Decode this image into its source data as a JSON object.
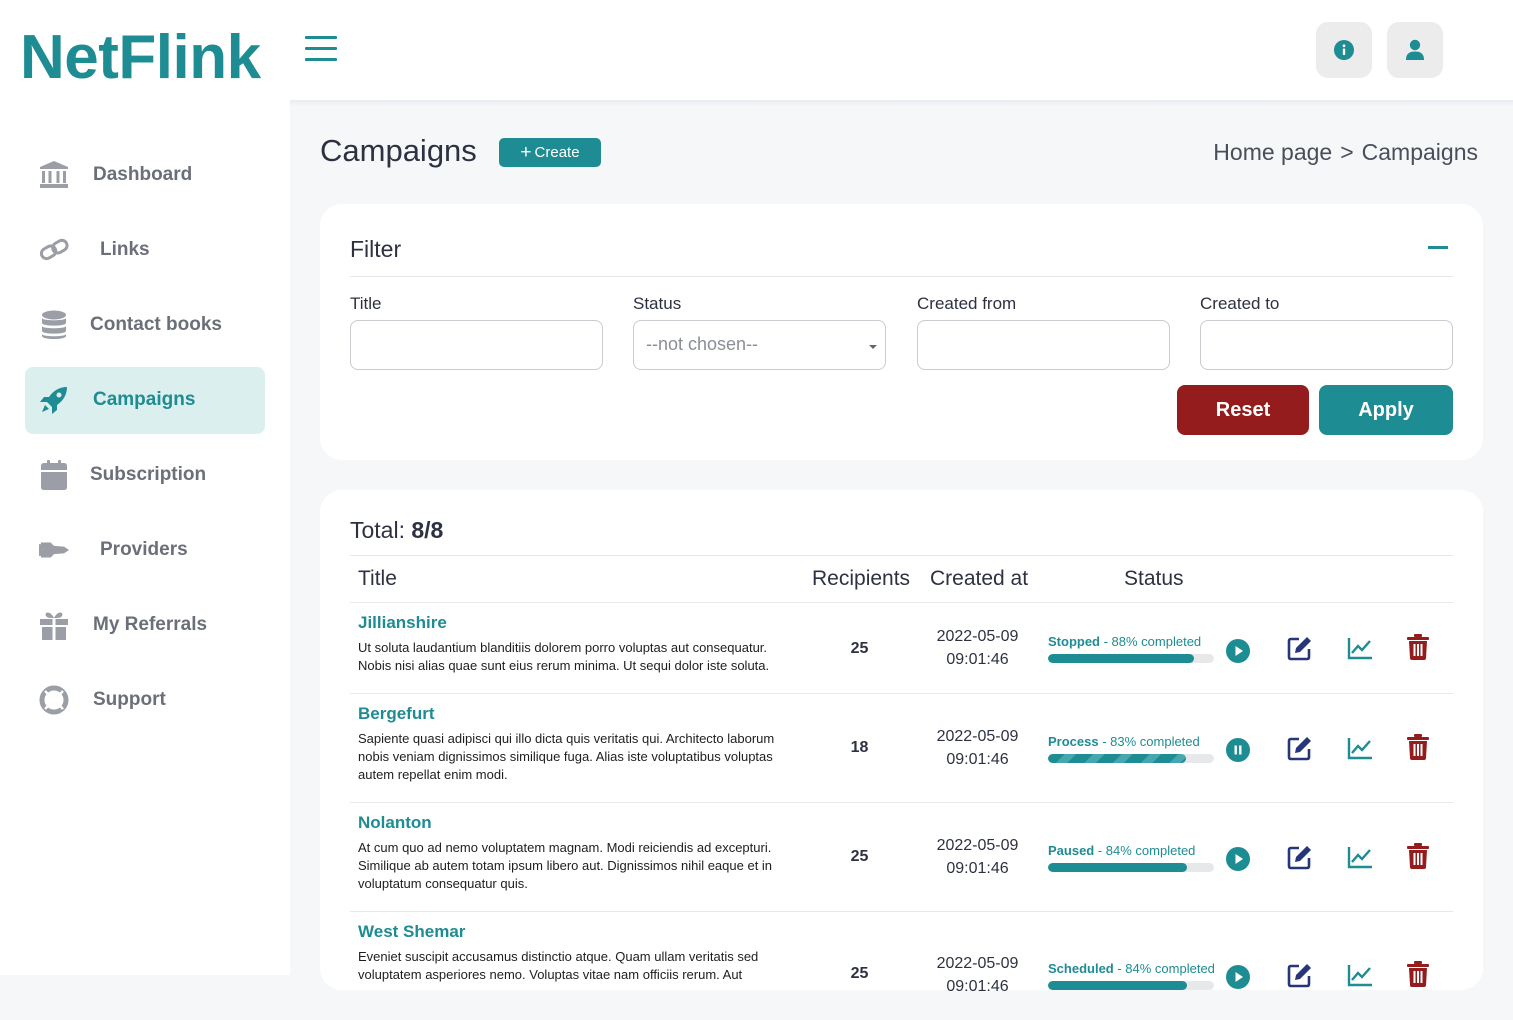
{
  "app": {
    "logo": "NetFlink"
  },
  "colors": {
    "accent": "#1e8c93",
    "danger": "#951c1c",
    "active_bg": "#dcefef"
  },
  "topbar": {
    "info_icon": "info-circle-icon",
    "user_icon": "user-icon"
  },
  "sidebar": {
    "items": [
      {
        "label": "Dashboard",
        "icon": "bank-icon",
        "active": false
      },
      {
        "label": "Links",
        "icon": "link-icon",
        "active": false
      },
      {
        "label": "Contact books",
        "icon": "database-icon",
        "active": false
      },
      {
        "label": "Campaigns",
        "icon": "rocket-icon",
        "active": true
      },
      {
        "label": "Subscription",
        "icon": "calendar-icon",
        "active": false
      },
      {
        "label": "Providers",
        "icon": "shuttle-icon",
        "active": false
      },
      {
        "label": "My Referrals",
        "icon": "gift-icon",
        "active": false
      },
      {
        "label": "Support",
        "icon": "lifebuoy-icon",
        "active": false
      }
    ]
  },
  "header": {
    "title": "Campaigns",
    "create_label": "Create",
    "breadcrumb": {
      "home": "Home page",
      "separator": ">",
      "current": "Campaigns"
    }
  },
  "filter": {
    "title": "Filter",
    "fields": {
      "title_label": "Title",
      "title_value": "",
      "status_label": "Status",
      "status_value": "--not chosen--",
      "created_from_label": "Created from",
      "created_from_value": "",
      "created_to_label": "Created to",
      "created_to_value": ""
    },
    "reset_label": "Reset",
    "apply_label": "Apply"
  },
  "table": {
    "total_label": "Total:",
    "total_value": "8/8",
    "columns": {
      "title": "Title",
      "recipients": "Recipients",
      "created_at": "Created at",
      "status": "Status"
    },
    "rows": [
      {
        "title": "Jillianshire",
        "description": "Ut soluta laudantium blanditiis dolorem porro voluptas aut consequatur. Nobis nisi alias quae sunt eius rerum minima. Ut sequi dolor iste soluta.",
        "recipients": "25",
        "date": "2022-05-09",
        "time": "09:01:46",
        "status": "Stopped",
        "status_suffix": " - 88% completed",
        "progress": 0.88,
        "control": "play-icon"
      },
      {
        "title": "Bergefurt",
        "description": "Sapiente quasi adipisci qui illo dicta quis veritatis qui. Architecto laborum nobis veniam dignissimos similique fuga. Alias iste voluptatibus voluptas autem repellat enim modi.",
        "recipients": "18",
        "date": "2022-05-09",
        "time": "09:01:46",
        "status": "Process",
        "status_suffix": " - 83% completed",
        "progress": 0.83,
        "control": "pause-icon"
      },
      {
        "title": "Nolanton",
        "description": "At cum quo ad nemo voluptatem magnam. Modi reiciendis ad excepturi. Similique ab autem totam ipsum libero aut. Dignissimos nihil eaque et in voluptatum consequatur quis.",
        "recipients": "25",
        "date": "2022-05-09",
        "time": "09:01:46",
        "status": "Paused",
        "status_suffix": " - 84% completed",
        "progress": 0.84,
        "control": "play-icon"
      },
      {
        "title": "West Shemar",
        "description": "Eveniet suscipit accusamus distinctio atque. Quam ullam veritatis sed voluptatem asperiores nemo. Voluptas vitae nam officiis rerum. Aut",
        "recipients": "25",
        "date": "2022-05-09",
        "time": "09:01:46",
        "status": "Scheduled",
        "status_suffix": " - 84% completed",
        "progress": 0.84,
        "control": "play-icon"
      }
    ]
  }
}
